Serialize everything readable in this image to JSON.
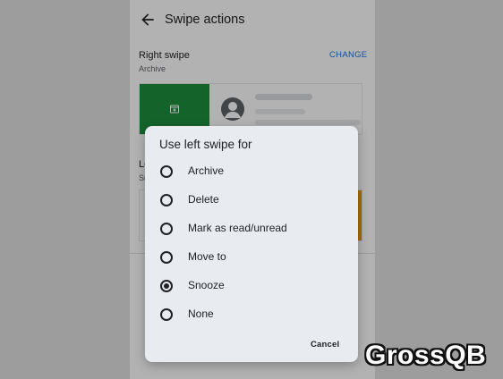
{
  "header": {
    "title": "Swipe actions",
    "back_icon": "arrow-back-icon"
  },
  "right_swipe": {
    "title": "Right swipe",
    "value": "Archive",
    "change_label": "CHANGE",
    "action_color": "#1e8e3e",
    "action_icon": "archive-icon"
  },
  "left_swipe": {
    "title_visible": "Le",
    "value_visible": "Sr",
    "change_visible": "E",
    "action_color": "#f29900"
  },
  "dialog": {
    "title": "Use left swipe for",
    "options": [
      {
        "label": "Archive",
        "selected": false
      },
      {
        "label": "Delete",
        "selected": false
      },
      {
        "label": "Mark as read/unread",
        "selected": false
      },
      {
        "label": "Move to",
        "selected": false
      },
      {
        "label": "Snooze",
        "selected": true
      },
      {
        "label": "None",
        "selected": false
      }
    ],
    "cancel_label": "Cancel"
  },
  "watermark": "GrossQB",
  "colors": {
    "accent": "#1a73e8",
    "dialog_bg": "#e8ecf1"
  }
}
